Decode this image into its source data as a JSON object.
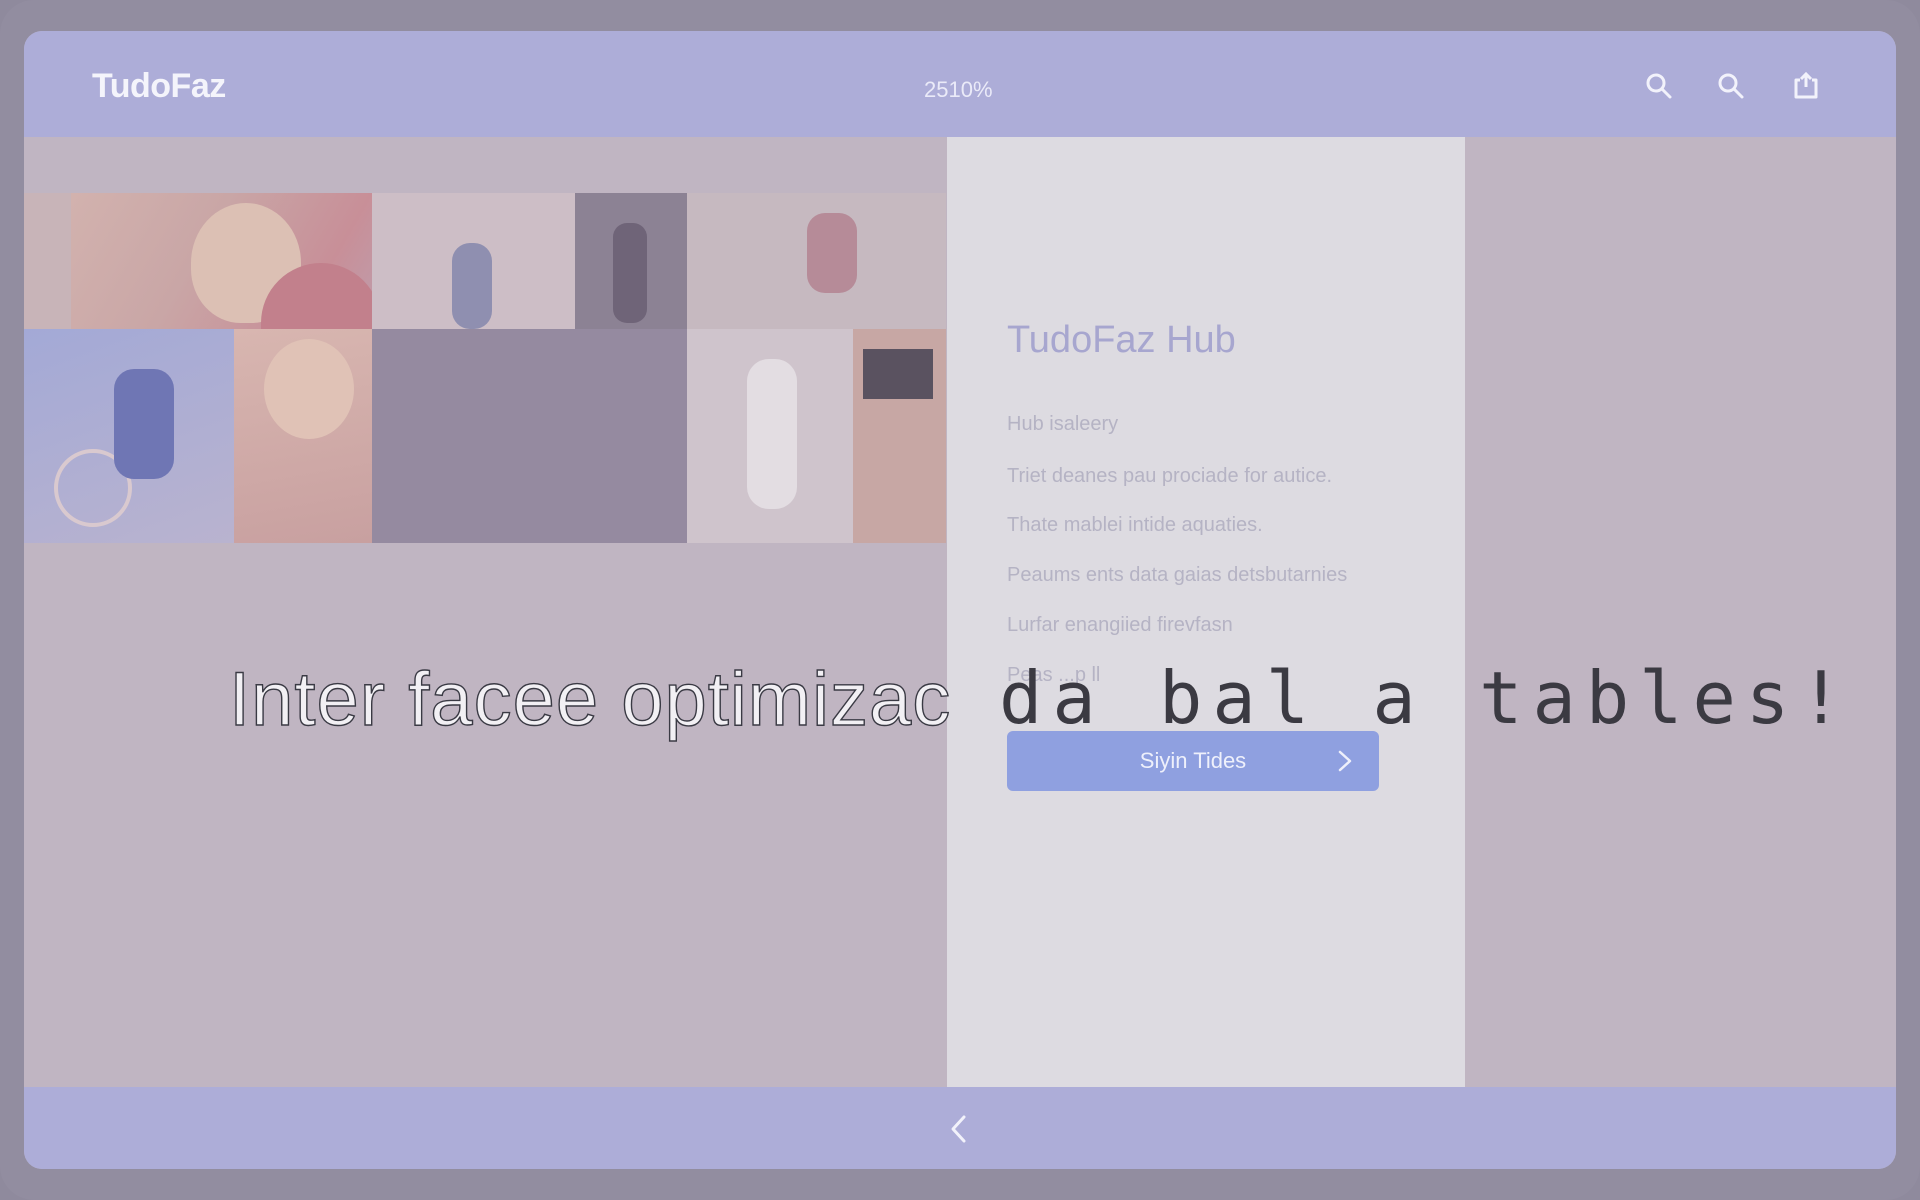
{
  "app": {
    "brand": "TudoFaz",
    "zoom_level": "2510%"
  },
  "toolbar": {
    "icons": [
      "search-icon",
      "search-icon",
      "share-icon"
    ]
  },
  "panel": {
    "title": "TudoFaz Hub",
    "lines": [
      "Hub isaleery",
      "Triet deanes pau prociade for autice.",
      "Thate mablei intide aquaties.",
      "Peaums ents data gaias detsbutarnies",
      "Lurfar enangiied firevfasn",
      "Peas ...p ll"
    ],
    "button_label": "Siyin Tides",
    "button_icon": "chevron-right-icon"
  },
  "overlay": {
    "part1": "Inter facee optimizac",
    "part2": "da bal a tables!"
  },
  "bottombar": {
    "icon": "chevron-left-icon"
  },
  "colors": {
    "bar": "#adadd8",
    "accent": "#8fa0e0",
    "panel": "#dddbe1",
    "background": "#c0b5c2"
  }
}
